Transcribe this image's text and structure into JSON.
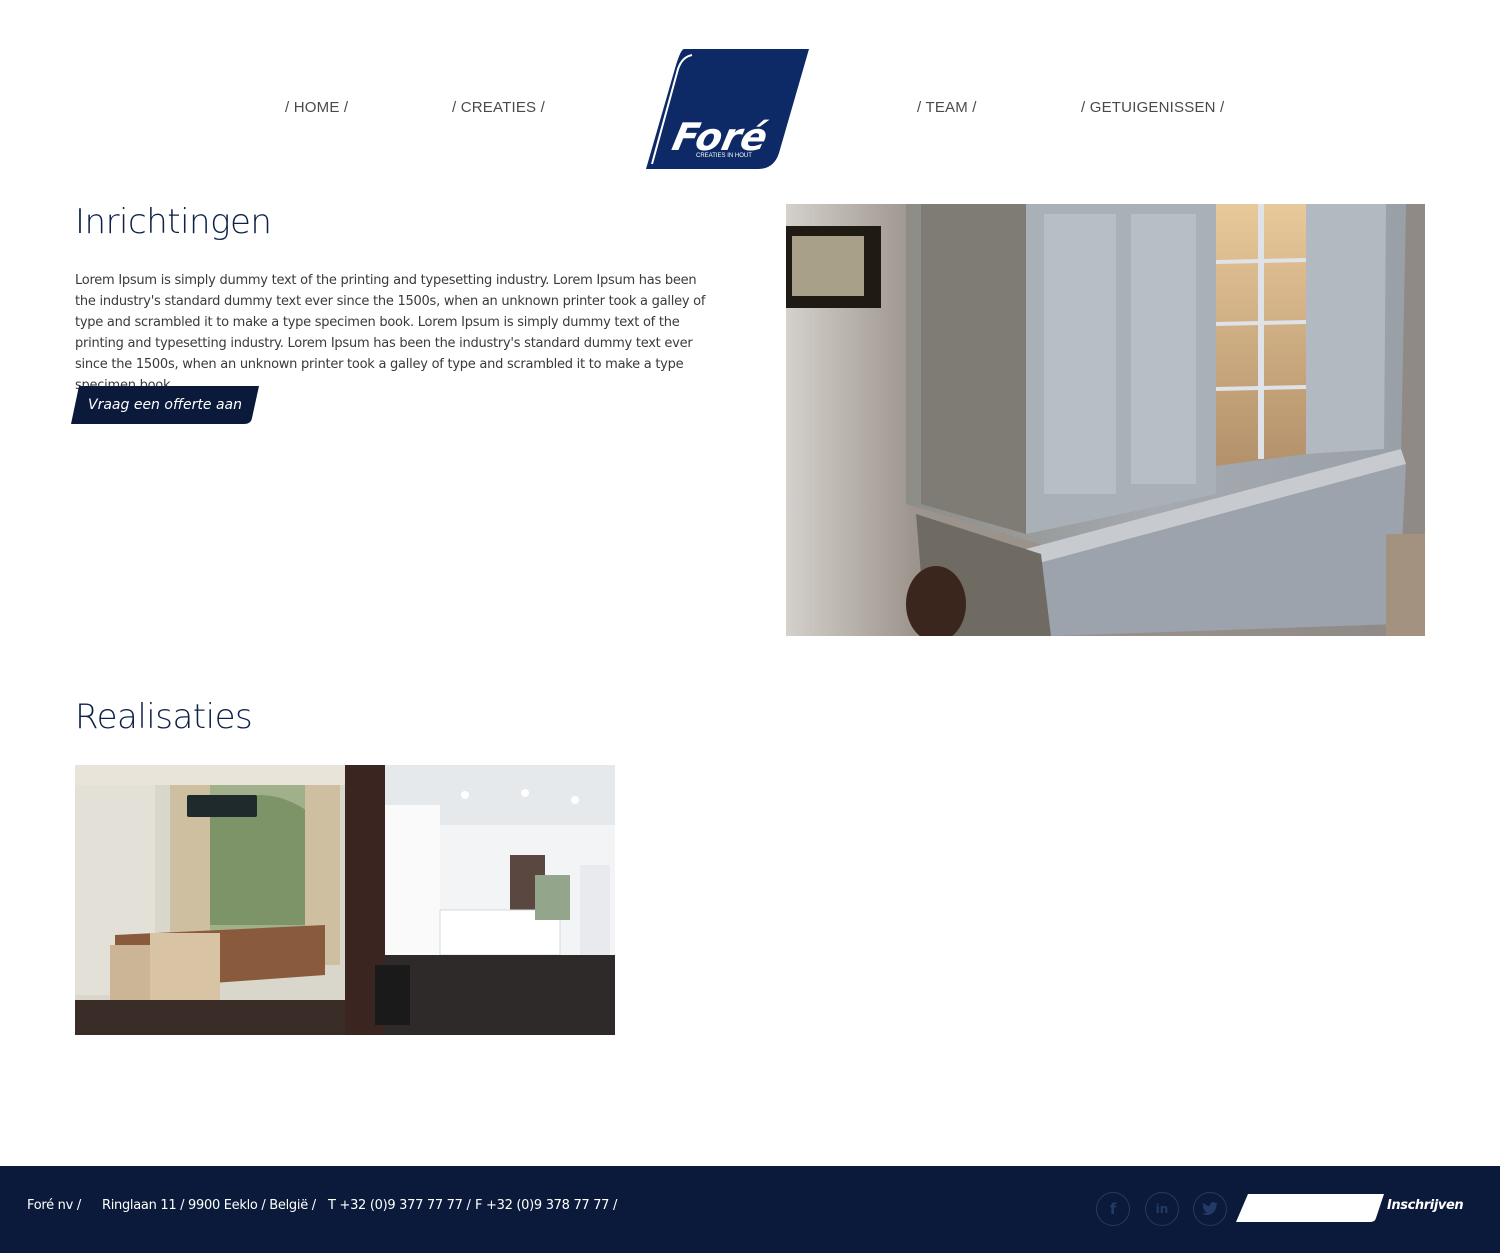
{
  "nav": {
    "home": "/ HOME /",
    "creaties": "/ CREATIES /",
    "team": "/ TEAM /",
    "getuigenissen": "/ GETUIGENISSEN /"
  },
  "logo": {
    "name": "Foré",
    "tagline": "CREATIES IN HOUT"
  },
  "intro": {
    "title": "Inrichtingen",
    "body": "Lorem Ipsum is simply dummy text of the printing and typesetting industry. Lorem Ipsum has been the industry's standard dummy text ever since the 1500s, when an unknown printer took a galley of type and scrambled it to make a type specimen book. Lorem Ipsum is simply dummy text of the printing and typesetting industry. Lorem Ipsum has been the industry's standard dummy text ever since the 1500s, when an unknown printer took a galley of type and scrambled it to make a type specimen book.",
    "cta": "Vraag een offerte aan"
  },
  "realisaties": {
    "title": "Realisaties"
  },
  "footer": {
    "company": "Foré nv /",
    "address": "Ringlaan 11 / 9900 Eeklo / België /",
    "phone": "T +32 (0)9 377 77 77 /",
    "fax": "F +32 (0)9 378 77 77 /",
    "social": [
      "facebook-icon",
      "linkedin-icon",
      "twitter-icon"
    ],
    "newsletter_placeholder": "",
    "subscribe": "Inschrijven"
  },
  "colors": {
    "brand_navy": "#0d2a66",
    "footer_bg": "#0b1a3a",
    "cta_bg": "#0b1a3a"
  }
}
